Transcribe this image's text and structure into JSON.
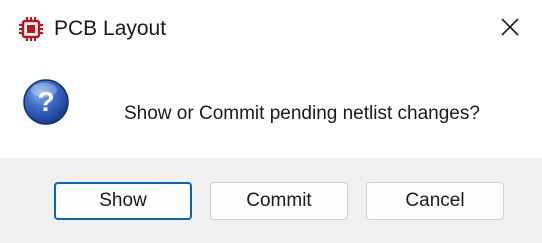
{
  "window": {
    "title": "PCB Layout",
    "app_icon": "chip-icon",
    "close_icon": "close-icon"
  },
  "dialog": {
    "icon": "question-icon",
    "message": "Show or Commit pending netlist changes?"
  },
  "buttons": {
    "show_label": "Show",
    "commit_label": "Commit",
    "cancel_label": "Cancel",
    "default": "Show"
  },
  "colors": {
    "accent": "#0067c0",
    "chip_red": "#c0141c",
    "question_blue": "#1f4fa8",
    "button_area_bg": "#f0f0f0"
  }
}
